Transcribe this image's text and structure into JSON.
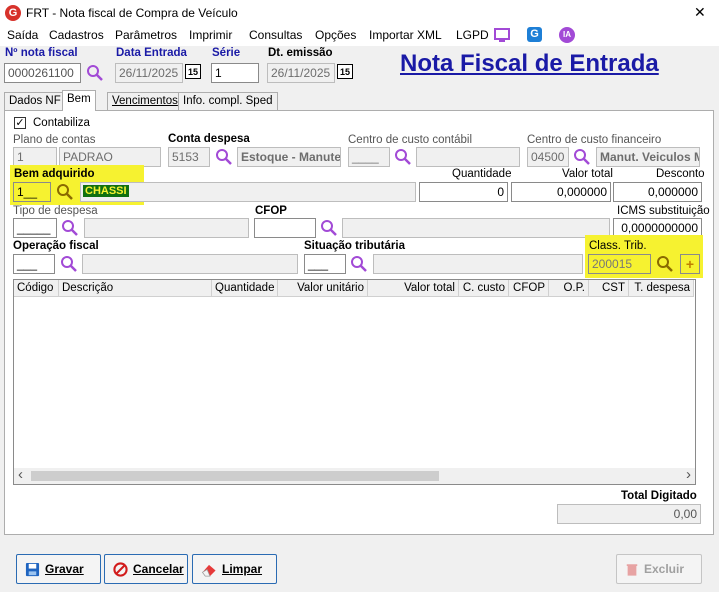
{
  "window": {
    "title": "FRT - Nota fiscal de Compra de Veículo",
    "close_glyph": "✕"
  },
  "menu": [
    "Saída",
    "Cadastros",
    "Parâmetros",
    "Imprimir",
    "Consultas",
    "Opções",
    "Importar XML",
    "LGPD"
  ],
  "menu_icons": [
    "monitor-icon",
    "g-app-icon",
    "ia-icon"
  ],
  "ia_text": "IA",
  "header": {
    "nota_fiscal_label": "Nº nota fiscal",
    "nota_fiscal_value": "0000261100",
    "data_entrada_label": "Data Entrada",
    "data_entrada_value": "26/11/2025",
    "serie_label": "Série",
    "serie_value": "1",
    "dt_emissao_label": "Dt. emissão",
    "dt_emissao_value": "26/11/2025",
    "calendar_text": "15",
    "big_title": "Nota Fiscal de Entrada"
  },
  "tabs": [
    "Dados NF",
    "Bem",
    "Vencimentos",
    "Info. compl. Sped"
  ],
  "active_tab": "Bem",
  "bem": {
    "contabiliza_label": "Contabiliza",
    "contabiliza_checked": true,
    "plano_contas_label": "Plano de contas",
    "plano_contas_code": "1",
    "plano_contas_name": "PADRAO",
    "conta_despesa_label": "Conta despesa",
    "conta_despesa_code": "5153",
    "conta_despesa_name": "Estoque - Manute",
    "centro_contabil_label": "Centro de custo contábil",
    "centro_contabil_code": "____",
    "centro_financeiro_label": "Centro de custo financeiro",
    "centro_financeiro_code": "04500",
    "centro_financeiro_name": "Manut. Veiculos M",
    "bem_adquirido_label": "Bem adquirido",
    "bem_adquirido_code": "1__",
    "bem_adquirido_name": "CHASSI",
    "quantidade_label": "Quantidade",
    "quantidade_value": "0",
    "valor_total_label": "Valor total",
    "valor_total_value": "0,000000",
    "desconto_label": "Desconto",
    "desconto_value": "0,000000",
    "tipo_despesa_label": "Tipo de despesa",
    "tipo_despesa_code": "_____",
    "cfop_label": "CFOP",
    "icms_label": "ICMS substituição",
    "icms_value": "0,0000000000",
    "operacao_fiscal_label": "Operação fiscal",
    "operacao_fiscal_code": "___",
    "situacao_tributaria_label": "Situação tributária",
    "situacao_tributaria_code": "___",
    "class_trib_label": "Class. Trib.",
    "class_trib_value": "200015",
    "plus_glyph": "+"
  },
  "grid": {
    "columns": [
      "Código",
      "Descrição",
      "Quantidade",
      "Valor unitário",
      "Valor total",
      "C. custo",
      "CFOP",
      "O.P.",
      "CST",
      "T. despesa"
    ],
    "rows": []
  },
  "scroll": {
    "left": "‹",
    "right": "›"
  },
  "totals": {
    "label": "Total Digitado",
    "value": "0,00"
  },
  "buttons": {
    "gravar": "Gravar",
    "cancelar": "Cancelar",
    "limpar": "Limpar",
    "excluir": "Excluir"
  },
  "colors": {
    "highlight": "#f6f230",
    "title_blue": "#1a1aa6",
    "purple_icon": "#a24ad6",
    "app_red": "#d7322b"
  }
}
